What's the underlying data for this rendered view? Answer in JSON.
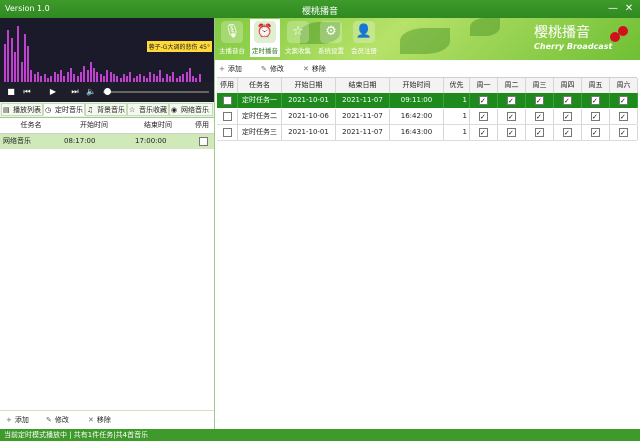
{
  "window": {
    "version": "Version 1.0",
    "title": "樱桃播音",
    "min_label": "—",
    "close_label": "✕"
  },
  "nav": [
    {
      "label": "主播音台",
      "icon": "microphone-icon"
    },
    {
      "label": "定时播音",
      "icon": "alarm-clock-icon"
    },
    {
      "label": "文案收集",
      "icon": "star-icon"
    },
    {
      "label": "系统设置",
      "icon": "settings-screen-icon"
    },
    {
      "label": "会员注册",
      "icon": "user-icon"
    }
  ],
  "nav_active": 1,
  "brand": {
    "cn": "樱桃播音",
    "en": "Cherry Broadcast",
    "cherry_color": "#d0101a"
  },
  "player": {
    "now_playing": "蓉子-G大调的悲伤 45°",
    "bar_color": "#c040d0"
  },
  "left_tabs": [
    {
      "label": "播放列表",
      "icon": "list-icon"
    },
    {
      "label": "定时音乐",
      "icon": "clock-icon"
    },
    {
      "label": "背景音乐",
      "icon": "music-note-icon"
    },
    {
      "label": "音乐收藏",
      "icon": "star-icon"
    },
    {
      "label": "网络音乐",
      "icon": "globe-icon"
    }
  ],
  "left_active_tab": 1,
  "left_table": {
    "headers": [
      "任务名",
      "开始时间",
      "结束时间",
      "停用"
    ],
    "rows": [
      {
        "name": "网络音乐",
        "start": "08:17:00",
        "end": "17:00:00",
        "disabled": false
      }
    ]
  },
  "left_toolbar": {
    "add": "添加",
    "edit": "修改",
    "remove": "移除"
  },
  "right_toolbar": {
    "add": "添加",
    "edit": "修改",
    "remove": "移除"
  },
  "schedule": {
    "headers": [
      "停用",
      "任务名",
      "开始日期",
      "结束日期",
      "开始时间",
      "优先",
      "周一",
      "周二",
      "周三",
      "周四",
      "周五",
      "周六",
      "周日"
    ],
    "rows": [
      {
        "disabled": false,
        "name": "定时任务一",
        "start_date": "2021-10-01",
        "end_date": "2021-11-07",
        "start_time": "09:11:00",
        "priority": "1",
        "days": [
          true,
          true,
          true,
          true,
          true,
          true,
          true
        ],
        "selected": true
      },
      {
        "disabled": false,
        "name": "定时任务二",
        "start_date": "2021-10-06",
        "end_date": "2021-11-07",
        "start_time": "16:42:00",
        "priority": "1",
        "days": [
          true,
          true,
          true,
          true,
          true,
          true,
          true
        ],
        "selected": false
      },
      {
        "disabled": false,
        "name": "定时任务三",
        "start_date": "2021-10-01",
        "end_date": "2021-11-07",
        "start_time": "16:43:00",
        "priority": "1",
        "days": [
          true,
          true,
          true,
          true,
          true,
          true,
          true
        ],
        "selected": false
      }
    ]
  },
  "status": "当前定时模式播放中 | 共有1件任务|共4首音乐",
  "colors": {
    "accent": "#3e9a2a",
    "selected_row": "#1e8a1e",
    "left_row": "#cfeab8"
  }
}
